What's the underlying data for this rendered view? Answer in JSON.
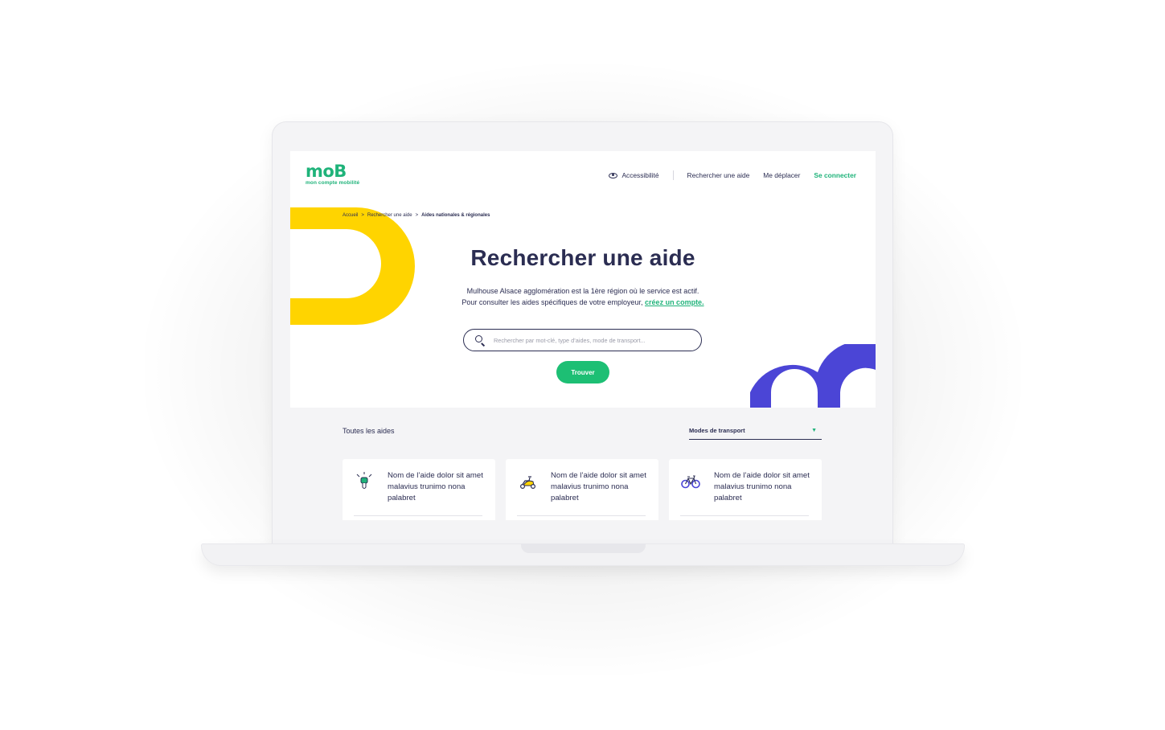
{
  "header": {
    "logo_word": "moB",
    "logo_tagline": "mon compte mobilité",
    "nav": {
      "accessibility": "Accessibilité",
      "search_aid": "Rechercher une aide",
      "move": "Me déplacer",
      "login": "Se connecter"
    }
  },
  "breadcrumb": {
    "items": [
      "Accueil",
      "Rechercher une aide",
      "Aides nationales & régionales"
    ],
    "separator": ">"
  },
  "hero": {
    "title": "Rechercher une aide",
    "line1": "Mulhouse Alsace agglomération est la 1ère région où le service est actif.",
    "line2_prefix": "Pour consulter les aides spécifiques de votre employeur, ",
    "line2_link": "créez un compte."
  },
  "search": {
    "placeholder": "Rechercher par mot-clé, type d’aides, mode de transport...",
    "button_label": "Trouver"
  },
  "filters": {
    "all_aids": "Toutes les aides",
    "transport_select": "Modes de transport"
  },
  "cards": [
    {
      "icon": "electric-plug-icon",
      "title": "Nom de l’aide dolor sit amet malavius trunimo nona palabret"
    },
    {
      "icon": "scooter-icon",
      "title": "Nom de l’aide dolor sit amet malavius trunimo nona palabret"
    },
    {
      "icon": "bicycle-icon",
      "title": "Nom de l’aide dolor sit amet malavius trunimo nona palabret"
    }
  ],
  "colors": {
    "brand_green": "#1fb37a",
    "button_green": "#1dbf74",
    "navy": "#2b2d52",
    "yellow": "#ffd400",
    "blue": "#4b45d6",
    "lower_bg": "#f4f4f6"
  }
}
